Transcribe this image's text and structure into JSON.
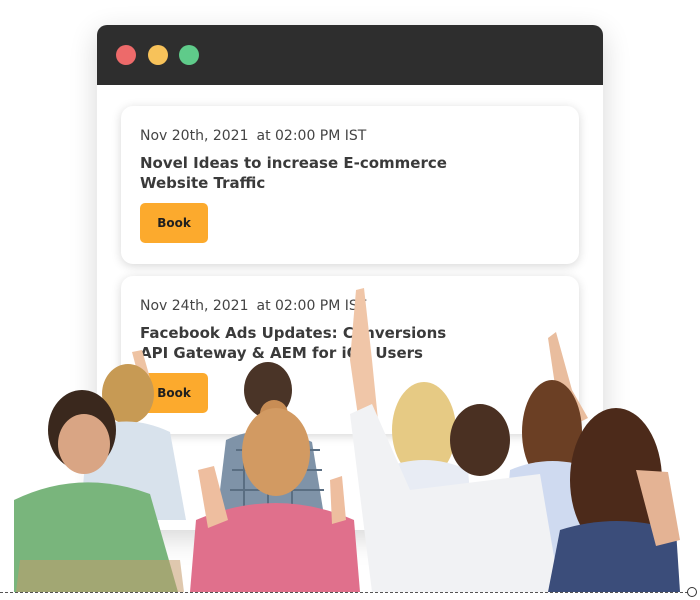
{
  "colors": {
    "titlebar": "#2e2e2e",
    "dot_red": "#ed6a6a",
    "dot_yellow": "#f7c25a",
    "dot_green": "#5fcb8a",
    "button": "#fcaa2d"
  },
  "events": [
    {
      "date": "Nov 20th, 2021",
      "time": "at 02:00 PM IST",
      "title": "Novel Ideas to increase E-commerce Website Traffic",
      "button_label": "Book"
    },
    {
      "date": "Nov 24th, 2021",
      "time": "at 02:00 PM IST",
      "title": "Facebook Ads Updates: Conversions API Gateway & AEM for iOS Users",
      "button_label": "Book"
    }
  ]
}
